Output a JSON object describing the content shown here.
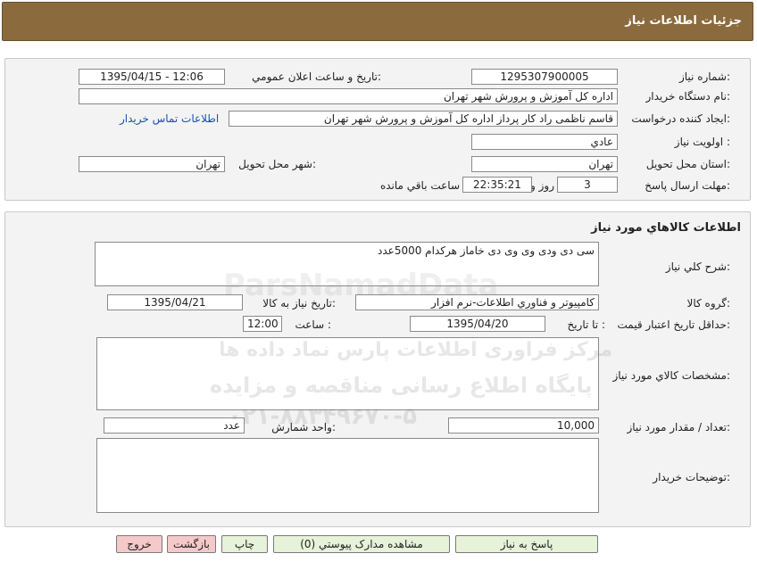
{
  "header": {
    "title": "جزئیات اطلاعات نیاز"
  },
  "info": {
    "need_number_label": "شماره نیاز:",
    "need_number": "1295307900005",
    "announce_label": "تاریخ و ساعت اعلان عمومي:",
    "announce_value": "1395/04/15 - 12:06",
    "buyer_org_label": "نام دستگاه خريدار:",
    "buyer_org": "اداره کل آموزش و پرورش شهر تهران",
    "creator_label": "ايجاد کننده درخواست:",
    "creator": "قاسم ناظمی راد کار پرداز  اداره کل آموزش و پرورش شهر تهران",
    "contact_link": "اطلاعات تماس خريدار",
    "priority_label": "اولويت نياز :",
    "priority": "عادي",
    "province_label": "استان محل تحويل:",
    "province": "تهران",
    "city_label": "شهر محل تحويل:",
    "city": "تهران",
    "deadline_label": "مهلت ارسال پاسخ:",
    "days": "3",
    "days_unit": "روز و",
    "time_left": "22:35:21",
    "time_left_label": "ساعت باقي مانده"
  },
  "goods": {
    "section_title": "اطلاعات کالاهاي مورد نياز",
    "summary_label": "شرح کلي نياز:",
    "summary": "سی دی ودی وی وی دی خاماز هرکدام 5000عدد",
    "group_label": "گروه کالا:",
    "group": "کامپيوتر و فناوري اطلاعات-نرم افزار",
    "need_date_label": "تاريخ نياز به کالا:",
    "need_date": "1395/04/21",
    "min_validity_label": "حداقل تاريخ اعتبار قيمت:",
    "to_date_label": "تا تاريخ :",
    "to_date": "1395/04/20",
    "hour_label": "ساعت :",
    "hour": "12:00",
    "specs_label": "مشخصات کالاي مورد نياز:",
    "qty_label": "تعداد / مقدار مورد نياز:",
    "qty": "10,000",
    "unit_label": "واحد شمارش:",
    "unit": "عدد",
    "buyer_notes_label": "توضيحات خريدار:"
  },
  "buttons": {
    "reply": "پاسخ به نياز",
    "attachments": "مشاهده مدارک پيوستي (0)",
    "print": "چاپ",
    "back": "بازگشت",
    "exit": "خروج"
  },
  "watermark": {
    "line1": "مرکز فراوری اطلاعات پارس نماد داده ها",
    "line2": "پایگاه اطلاع رسانی مناقصه و مزایده",
    "line3": "۰۲۱-۸۸۳۴۹۶۷۰-۵",
    "brand": "ParsNamadData"
  },
  "colors": {
    "header_bg": "#8b6a3e",
    "link": "#1a4fb0",
    "panel_bg": "#f3f3f3"
  }
}
